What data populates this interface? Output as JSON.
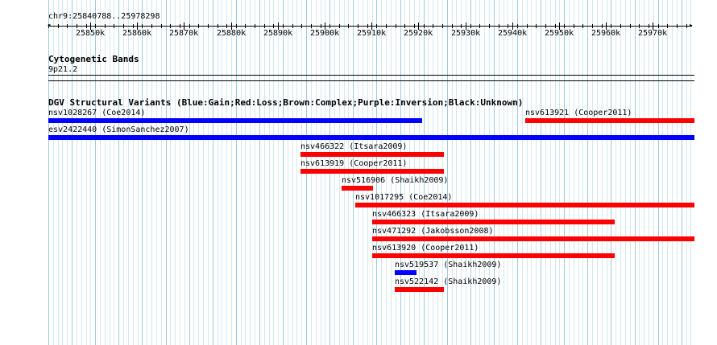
{
  "ruler": {
    "position_label": "chr9:25840788..25978298",
    "ticks": [
      "25850k",
      "25860k",
      "25870k",
      "25880k",
      "25890k",
      "25900k",
      "25910k",
      "25920k",
      "25930k",
      "25940k",
      "25950k",
      "25960k",
      "25970k"
    ]
  },
  "cytobands": {
    "title": "Cytogenetic Bands",
    "band": "9p21.2"
  },
  "dgv": {
    "title": "DGV Structural Variants (Blue:Gain;Red:Loss;Brown:Complex;Purple:Inversion;Black:Unknown)",
    "features": [
      {
        "label": "nsv1028267 (Coe2014)",
        "type": "gain"
      },
      {
        "label": "nsv613921 (Cooper2011)",
        "type": "loss"
      },
      {
        "label": "esv2422440 (SimonSanchez2007)",
        "type": "gain"
      },
      {
        "label": "nsv466322 (Itsara2009)",
        "type": "loss"
      },
      {
        "label": "nsv613919 (Cooper2011)",
        "type": "loss"
      },
      {
        "label": "nsv516906 (Shaikh2009)",
        "type": "loss"
      },
      {
        "label": "nsv1017295 (Coe2014)",
        "type": "loss"
      },
      {
        "label": "nsv466323 (Itsara2009)",
        "type": "loss"
      },
      {
        "label": "nsv471292 (Jakobsson2008)",
        "type": "loss"
      },
      {
        "label": "nsv613920 (Cooper2011)",
        "type": "loss"
      },
      {
        "label": "nsv519537 (Shaikh2009)",
        "type": "gain"
      },
      {
        "label": "nsv522142 (Shaikh2009)",
        "type": "loss"
      }
    ]
  },
  "colors": {
    "gain": "#0000ff",
    "loss": "#ff0000",
    "grid_major": "#9fc9de",
    "grid_minor": "#d4e8f1"
  }
}
